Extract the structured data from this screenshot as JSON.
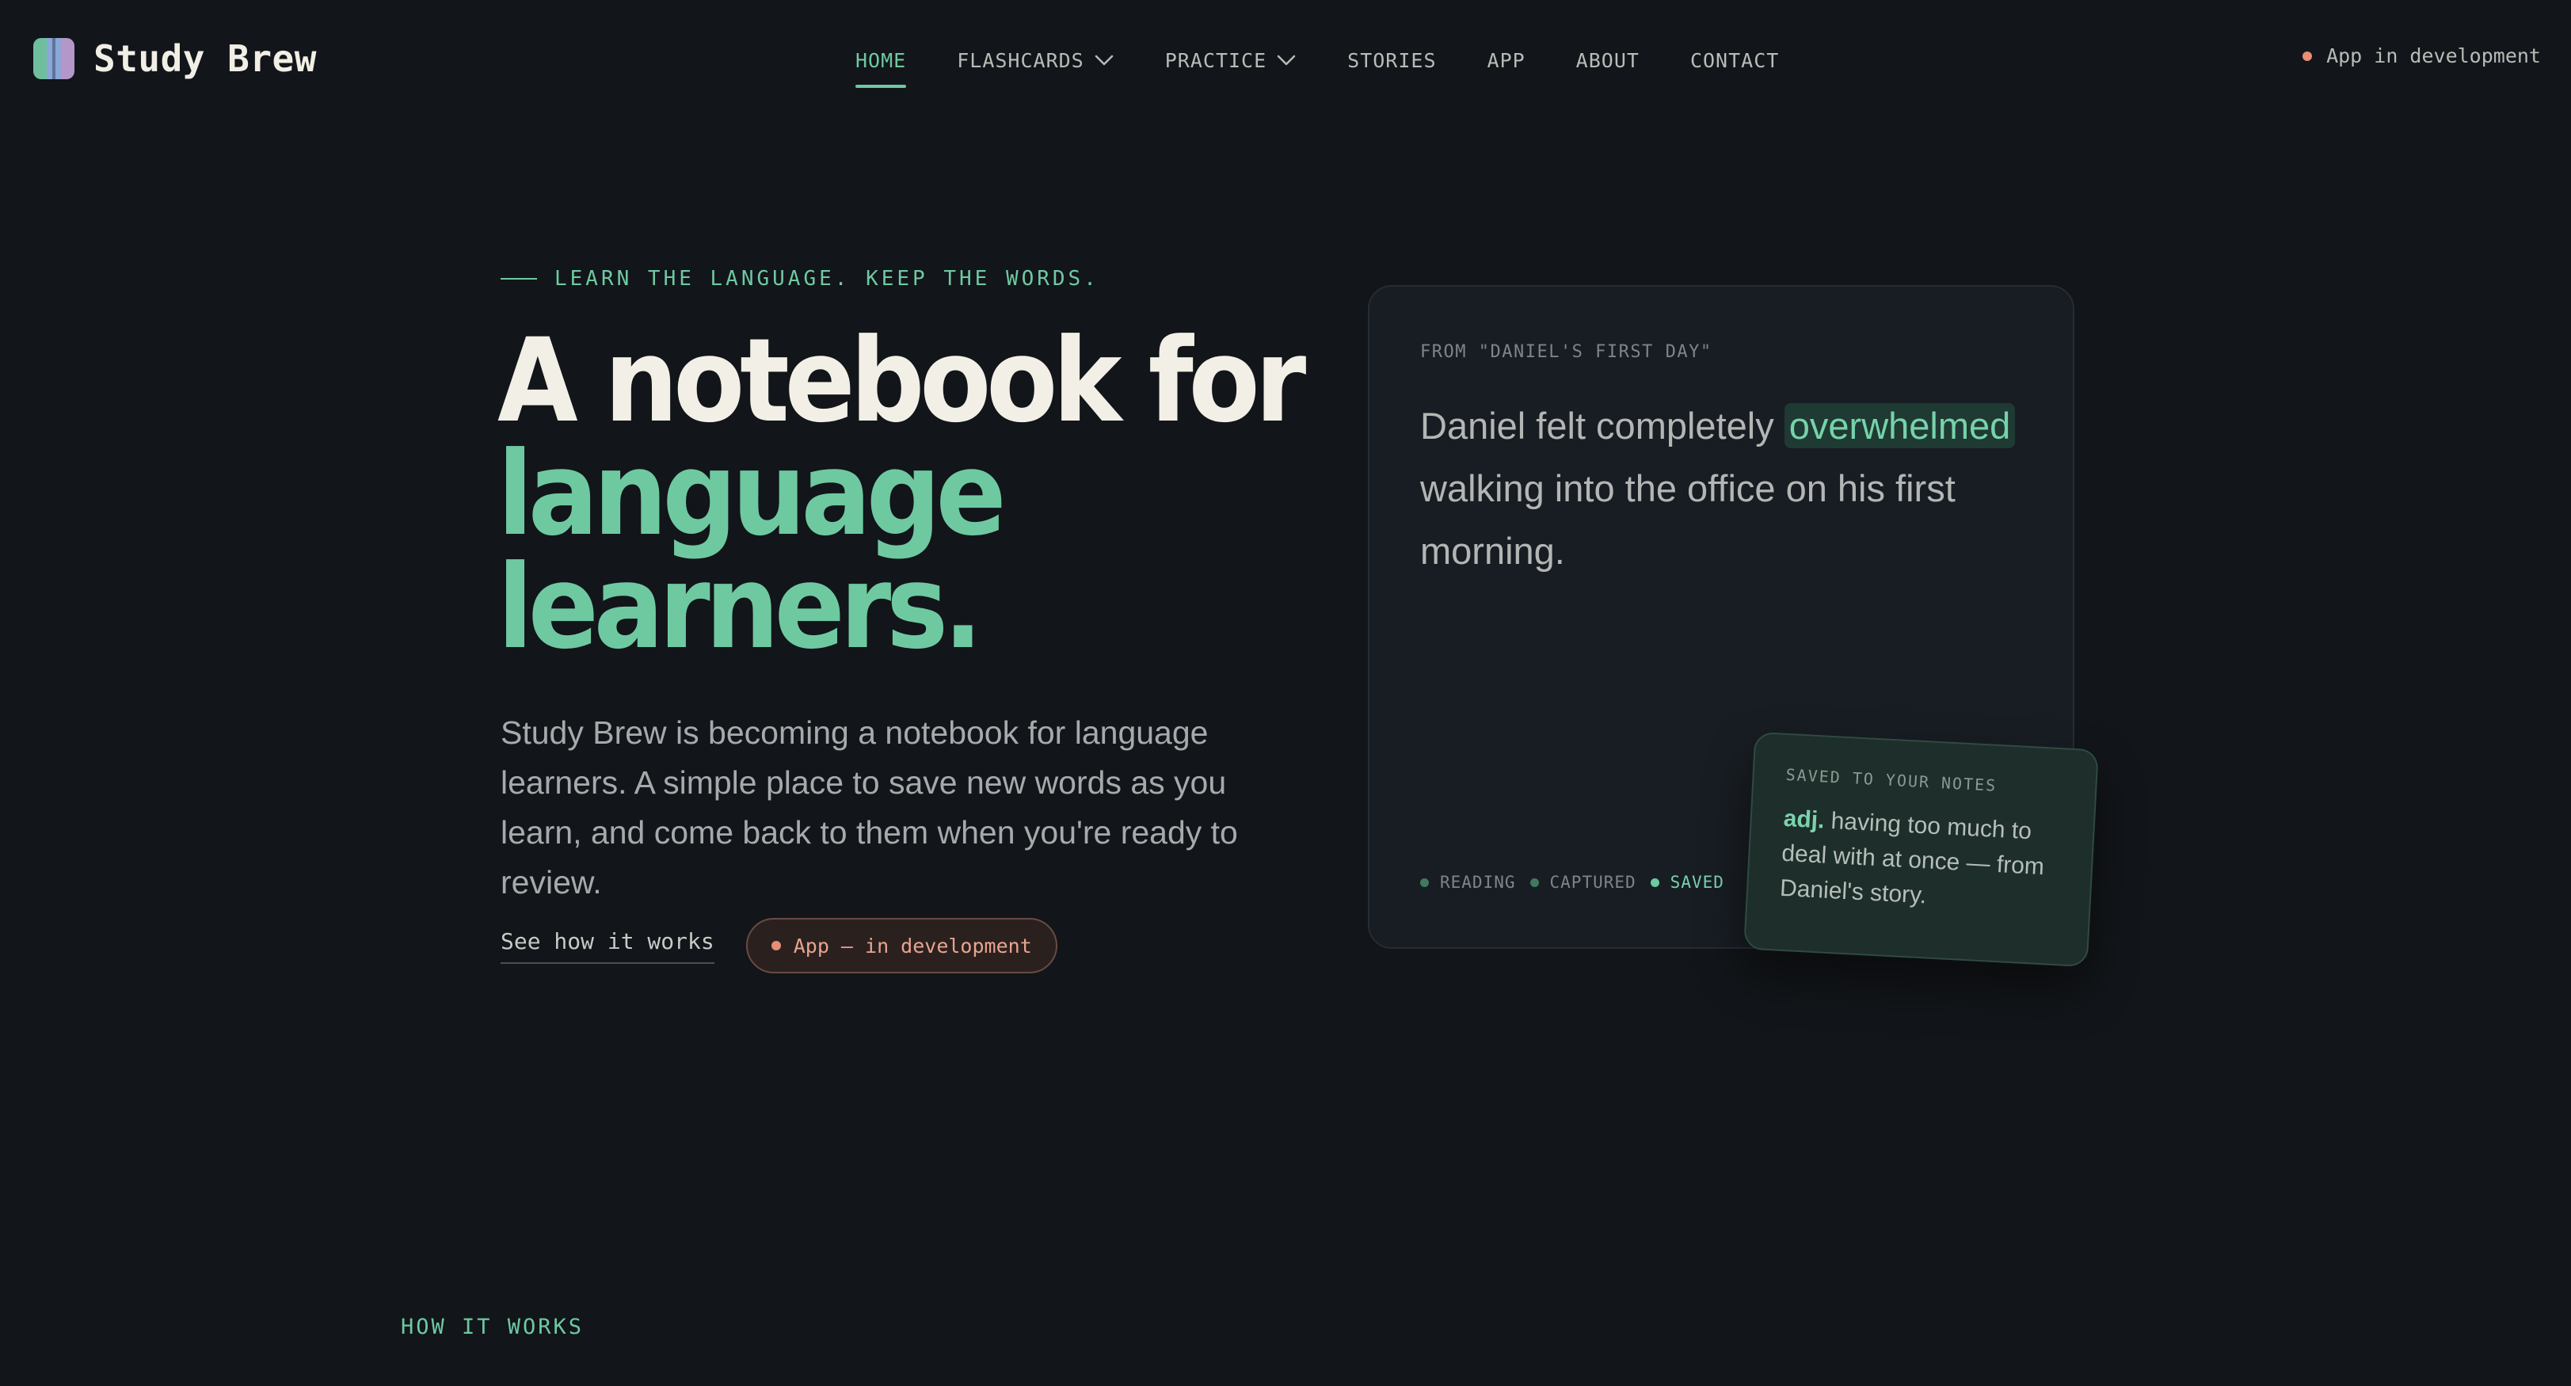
{
  "brand": {
    "name": "Study Brew",
    "logo_colors": [
      "#6fbf9e",
      "#8ba6d8",
      "#b497c9"
    ]
  },
  "nav": {
    "items": [
      {
        "label": "HOME",
        "active": true,
        "has_dropdown": false
      },
      {
        "label": "FLASHCARDS",
        "active": false,
        "has_dropdown": true
      },
      {
        "label": "PRACTICE",
        "active": false,
        "has_dropdown": true
      },
      {
        "label": "STORIES",
        "active": false,
        "has_dropdown": false
      },
      {
        "label": "APP",
        "active": false,
        "has_dropdown": false
      },
      {
        "label": "ABOUT",
        "active": false,
        "has_dropdown": false
      },
      {
        "label": "CONTACT",
        "active": false,
        "has_dropdown": false
      }
    ],
    "status_text": "App in development"
  },
  "hero": {
    "eyebrow": "LEARN THE LANGUAGE. KEEP THE WORDS.",
    "headline_line1": "A notebook for",
    "headline_line2": "language",
    "headline_line3": "learners.",
    "lead": "Study Brew is becoming a notebook for language learners. A simple place to save new words as you learn, and come back to them when you're ready to review.",
    "cta_link": "See how it works",
    "cta_pill": "App — in development"
  },
  "story_card": {
    "source": "FROM \"DANIEL'S FIRST DAY\"",
    "sentence_before": "Daniel felt completely ",
    "highlight_word": "overwhelmed",
    "sentence_after": " walking into the office on his first morning.",
    "statuses": [
      "READING",
      "CAPTURED",
      "SAVED"
    ]
  },
  "note_card": {
    "title": "SAVED TO YOUR NOTES",
    "part_of_speech": "adj.",
    "definition": " having too much to deal with at once — from Daniel's story."
  },
  "next_section": {
    "label": "HOW IT WORKS"
  },
  "colors": {
    "background": "#121519",
    "accent_green": "#6ec9a1",
    "accent_coral": "#e98d74",
    "card": "#181d23"
  }
}
